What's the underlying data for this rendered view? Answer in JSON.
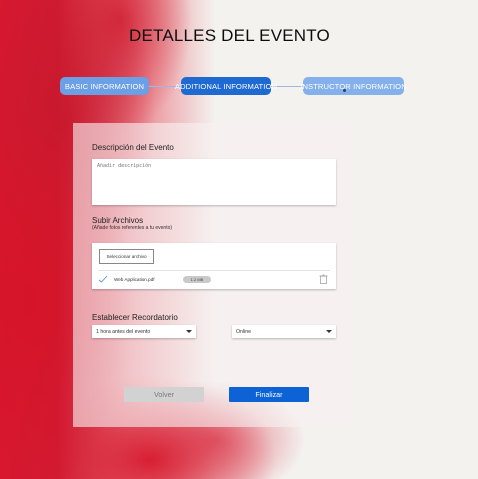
{
  "page_title": "DETALLES DEL EVENTO",
  "stepper": {
    "steps": [
      {
        "label": "BASIC INFORMATION",
        "state": "completed"
      },
      {
        "label": "ADDITIONAL INFORMATION",
        "state": "active"
      },
      {
        "label": "INSTRUCTOR INFORMATION",
        "state": "upcoming"
      }
    ]
  },
  "form": {
    "description": {
      "label": "Descripción del Evento",
      "placeholder": "Añadir descripción",
      "value": ""
    },
    "uploads": {
      "label": "Subir Archivos",
      "hint": "(Añade fotos referentes a tu evento)",
      "select_button": "Seleccionar archivo",
      "file": {
        "name": "Web Application.pdf",
        "size": "1.2 MB",
        "status_icon": "check-icon",
        "remove_icon": "trash-icon"
      }
    },
    "reminder": {
      "label": "Establecer Recordatorio",
      "time_selected": "1 hora antes del evento",
      "channel_selected": "Online"
    }
  },
  "actions": {
    "back_label": "Volver",
    "finish_label": "Finalizar"
  },
  "colors": {
    "primary": "#0d63d6",
    "step_active": "#1f69d2",
    "step_inactive": "#6b9fe6",
    "brand_red": "#d8182f"
  }
}
